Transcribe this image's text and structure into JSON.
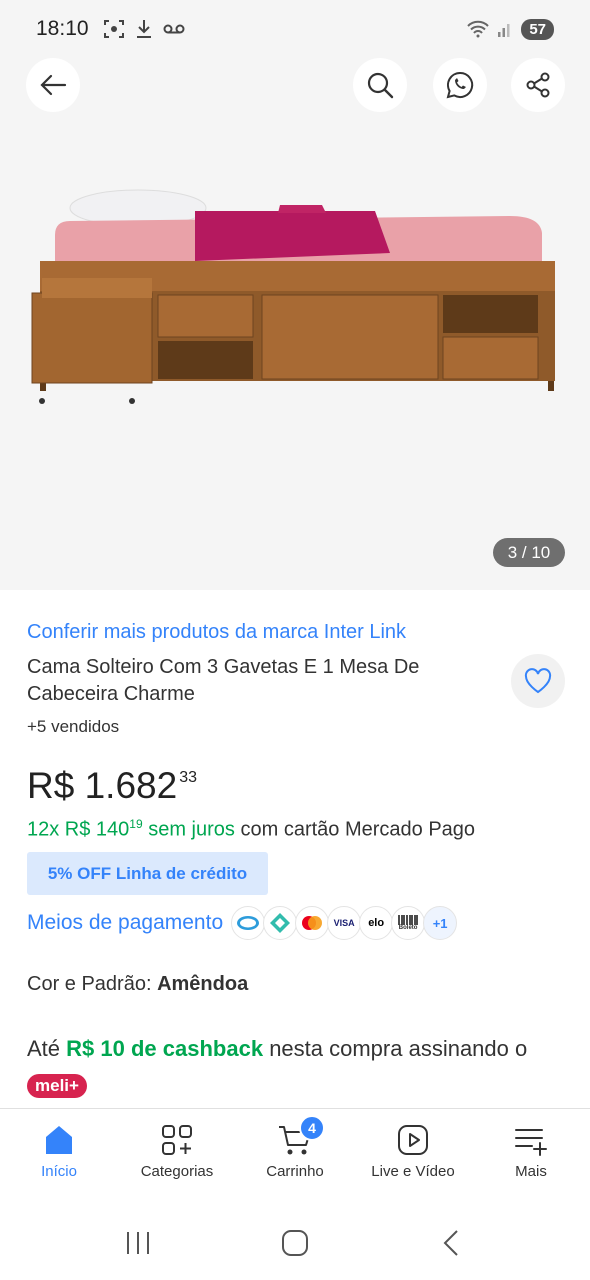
{
  "status_bar": {
    "time": "18:10",
    "battery": "57"
  },
  "gallery": {
    "counter": "3 / 10"
  },
  "product": {
    "brand_link": "Conferir mais produtos da marca Inter Link",
    "title": "Cama Solteiro Com 3 Gavetas E 1 Mesa De Cabeceira Charme",
    "sold": "+5 vendidos",
    "price_currency": "R$",
    "price_int": "1.682",
    "price_cents": "33",
    "installments_count": "12x R$ 140",
    "installments_cents": "19",
    "installments_interest": "sem juros",
    "installments_suffix": "com cartão Mercado Pago",
    "credit_badge": "5% OFF Linha de crédito",
    "payment_label": "Meios de pagamento",
    "payment_more": "+1",
    "color_label": "Cor e Padrão:",
    "color_value": "Amêndoa",
    "cashback_prefix": "Até",
    "cashback_amount": "R$ 10 de cashback",
    "cashback_mid": "nesta compra assinando o",
    "meli_badge": "meli+"
  },
  "payment_icons": [
    "mercado-pago-icon",
    "pix-icon",
    "mastercard-icon",
    "visa-icon",
    "elo-icon",
    "boleto-icon"
  ],
  "payment_icon_text": {
    "visa": "VISA",
    "elo": "elo",
    "boleto": "Boleto"
  },
  "bottom_nav": {
    "items": [
      {
        "label": "Início",
        "icon": "home-icon"
      },
      {
        "label": "Categorias",
        "icon": "grid-icon"
      },
      {
        "label": "Carrinho",
        "icon": "cart-icon",
        "badge": "4"
      },
      {
        "label": "Live e Vídeo",
        "icon": "play-icon"
      },
      {
        "label": "Mais",
        "icon": "menu-plus-icon"
      }
    ]
  },
  "colors": {
    "accent": "#3483fa",
    "green": "#00a650",
    "meli": "#d7234f"
  }
}
